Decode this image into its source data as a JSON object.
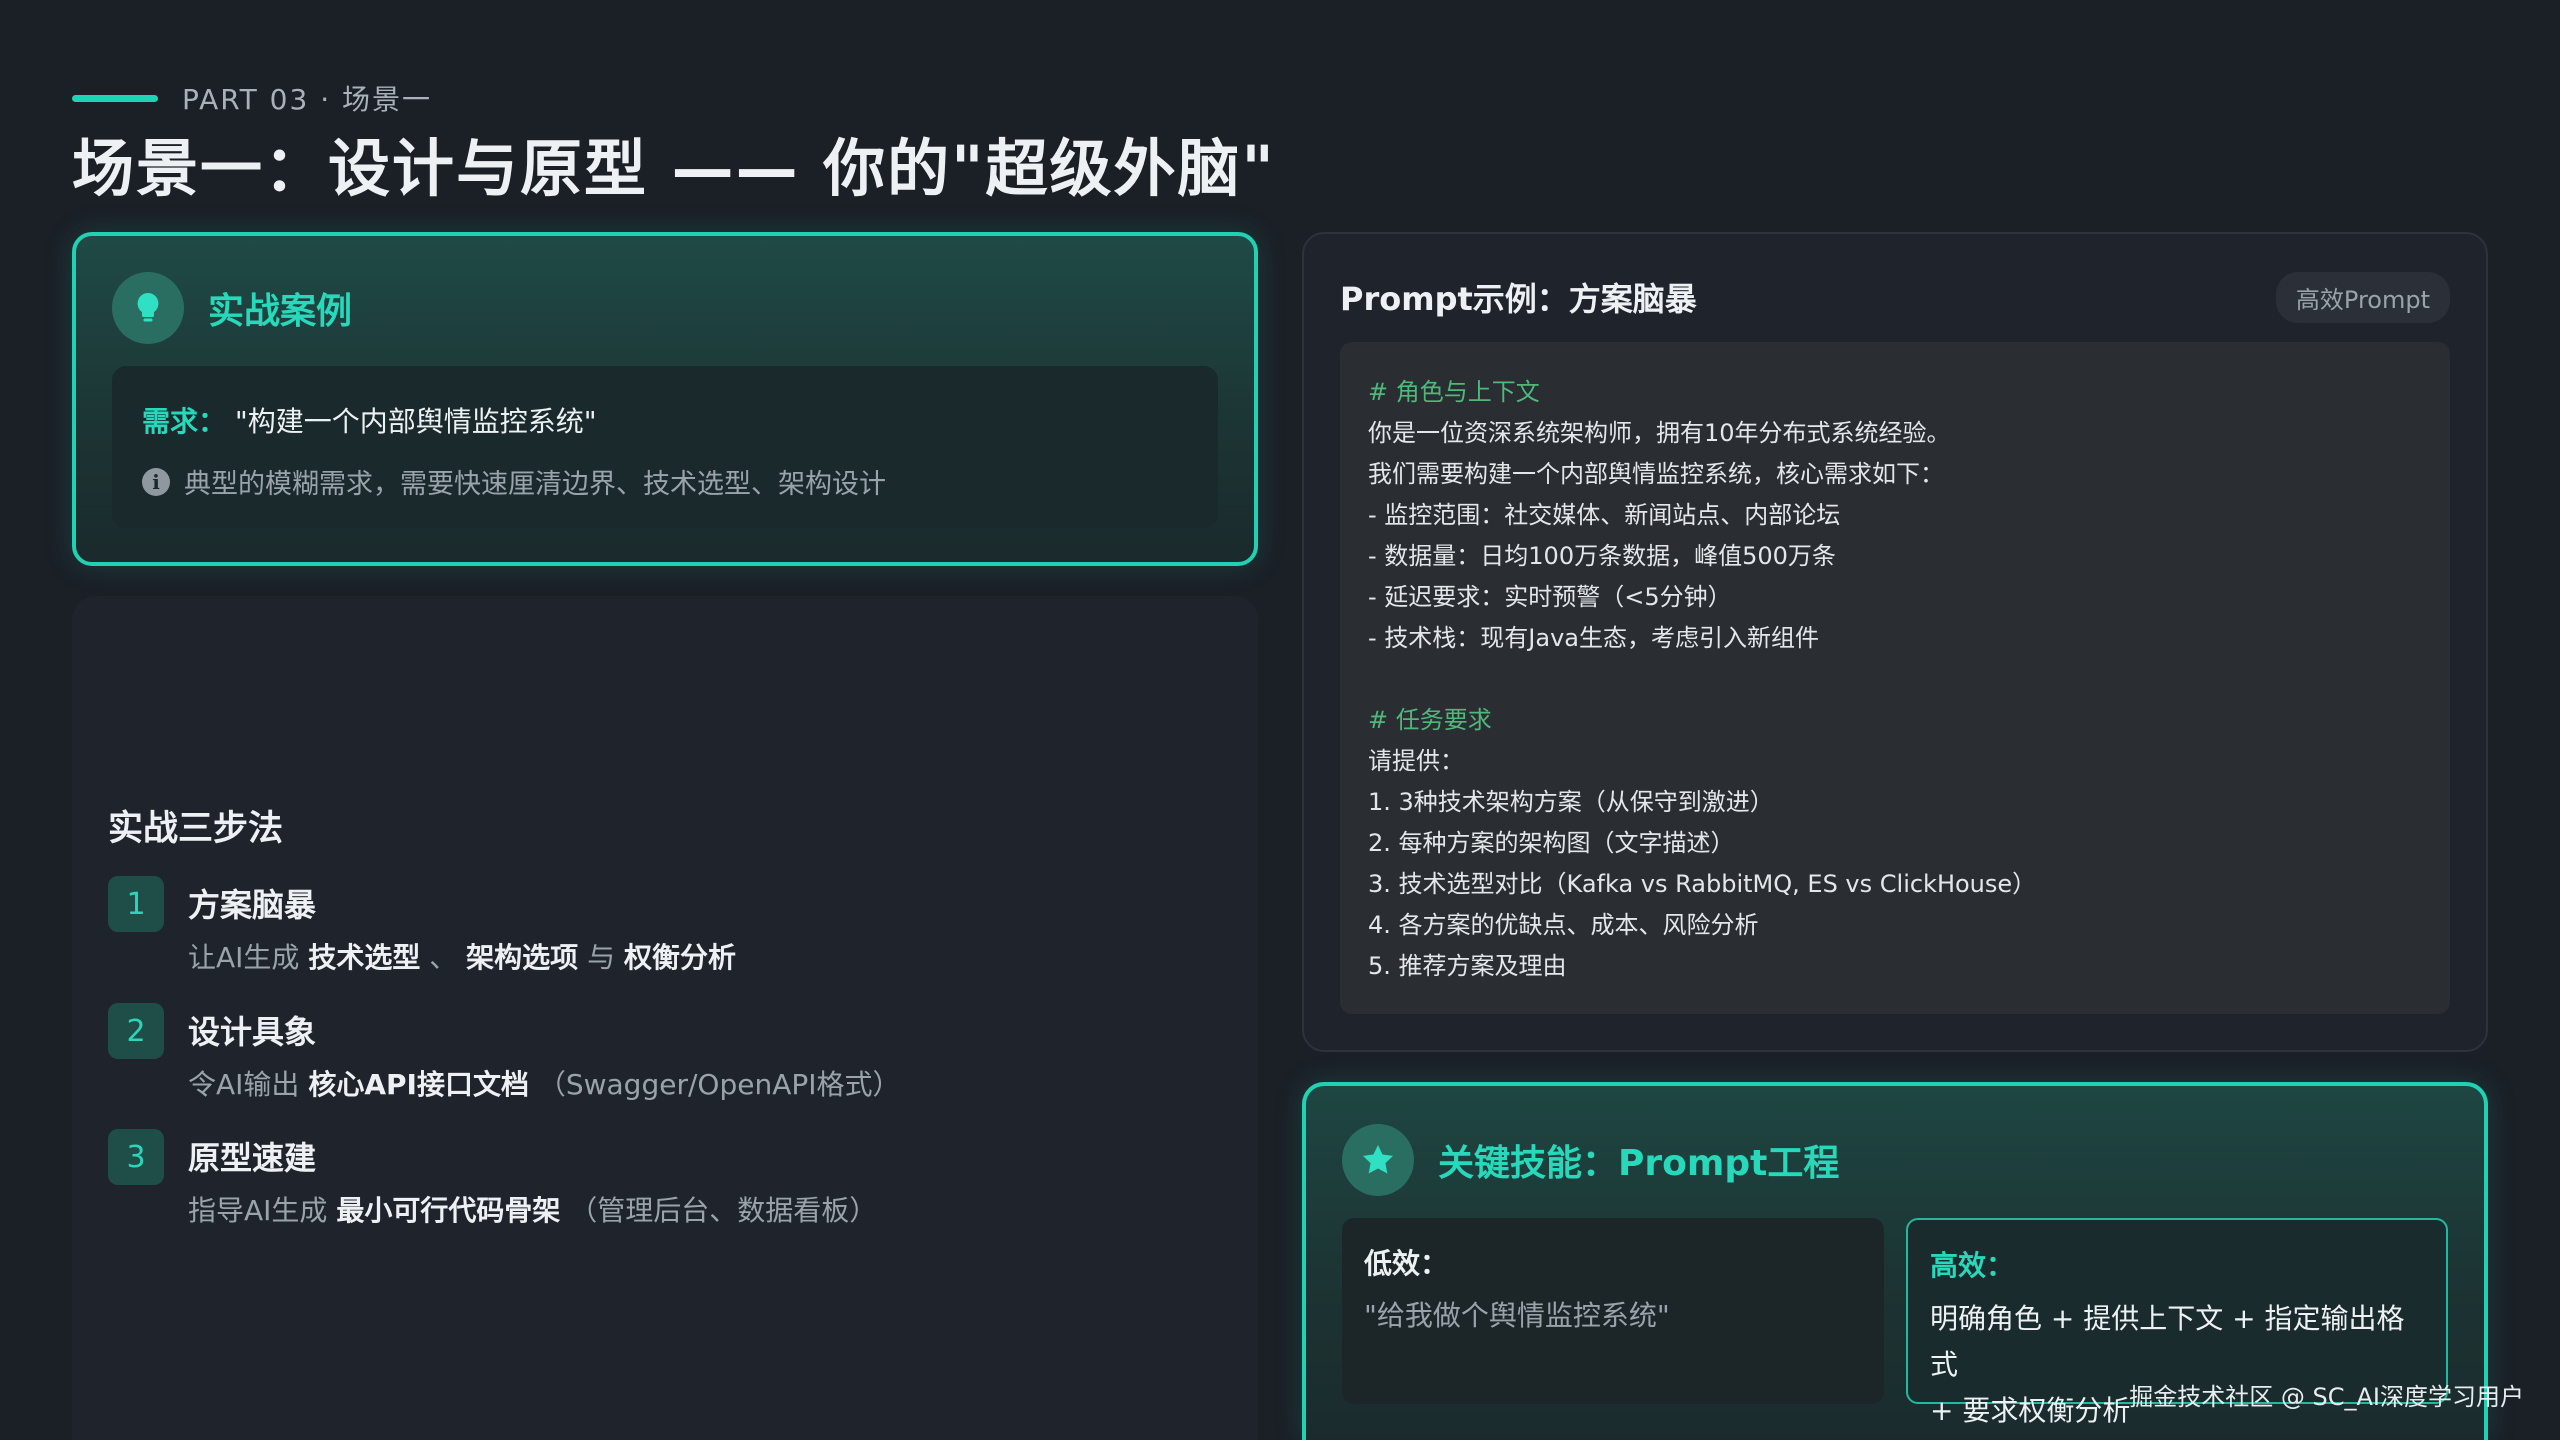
{
  "header": {
    "eyebrow": "PART 03 · 场景一",
    "title": "场景一：设计与原型 —— 你的\"超级外脑\"",
    "accent_color": "#1ed3b6"
  },
  "case": {
    "icon": "lightbulb-icon",
    "title": "实战案例",
    "requirement_label": "需求：",
    "requirement_value": "\"构建一个内部舆情监控系统\"",
    "note_icon": "info-icon",
    "note": "典型的模糊需求，需要快速厘清边界、技术选型、架构设计"
  },
  "steps": {
    "title": "实战三步法",
    "items": [
      {
        "num": "1",
        "title": "方案脑暴",
        "desc": [
          {
            "t": "让AI生成 "
          },
          {
            "t": "技术选型",
            "b": true
          },
          {
            "t": " 、 "
          },
          {
            "t": "架构选项",
            "b": true
          },
          {
            "t": " 与 "
          },
          {
            "t": "权衡分析",
            "b": true
          }
        ]
      },
      {
        "num": "2",
        "title": "设计具象",
        "desc": [
          {
            "t": "令AI输出 "
          },
          {
            "t": "核心API接口文档",
            "b": true
          },
          {
            "t": " （Swagger/OpenAPI格式）"
          }
        ]
      },
      {
        "num": "3",
        "title": "原型速建",
        "desc": [
          {
            "t": "指导AI生成 "
          },
          {
            "t": "最小可行代码骨架",
            "b": true
          },
          {
            "t": " （管理后台、数据看板）"
          }
        ]
      }
    ]
  },
  "prompt": {
    "title": "Prompt示例：方案脑暴",
    "badge": "高效Prompt",
    "lines": [
      {
        "text": "# 角色与上下文",
        "comment": true
      },
      {
        "text": "你是一位资深系统架构师，拥有10年分布式系统经验。"
      },
      {
        "text": "我们需要构建一个内部舆情监控系统，核心需求如下："
      },
      {
        "text": "- 监控范围：社交媒体、新闻站点、内部论坛"
      },
      {
        "text": "- 数据量：日均100万条数据，峰值500万条"
      },
      {
        "text": "- 延迟要求：实时预警（<5分钟）"
      },
      {
        "text": "- 技术栈：现有Java生态，考虑引入新组件"
      },
      {
        "text": "",
        "gap": true
      },
      {
        "text": "# 任务要求",
        "comment": true
      },
      {
        "text": "请提供："
      },
      {
        "text": "1. 3种技术架构方案（从保守到激进）"
      },
      {
        "text": "2. 每种方案的架构图（文字描述）"
      },
      {
        "text": "3. 技术选型对比（Kafka vs RabbitMQ, ES vs ClickHouse）"
      },
      {
        "text": "4. 各方案的优缺点、成本、风险分析"
      },
      {
        "text": "5. 推荐方案及理由"
      }
    ]
  },
  "skill": {
    "icon": "star-icon",
    "title": "关键技能：Prompt工程",
    "bad_label": "低效：",
    "bad_text": "\"给我做个舆情监控系统\"",
    "good_label": "高效：",
    "good_text_1": "明确角色 + 提供上下文 + 指定输出格式",
    "good_text_2": "+ 要求权衡分析"
  },
  "watermark": "掘金技术社区 @ SC_AI深度学习用户"
}
